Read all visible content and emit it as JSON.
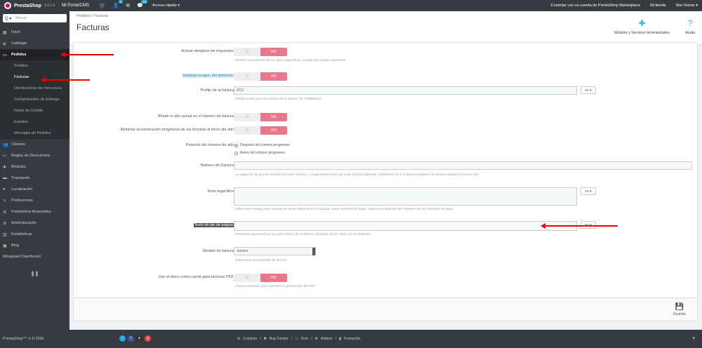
{
  "topbar": {
    "brand": "PrestaShop",
    "version": "1.6.1.5",
    "shop": "Mi Portal/CMS",
    "orders_badge": "1",
    "messages_badge": "13",
    "quick_access": "Acceso rápido ▾",
    "connect": "Conectar con su cuenta de PrestaShop Marketplace",
    "my_shop": "Mi tienda",
    "user": "Site Owner ▾"
  },
  "sidebar": {
    "search_placeholder": "Buscar",
    "items": [
      {
        "label": "Inicio",
        "icon": "dashboard-icon"
      },
      {
        "label": "Catálogo",
        "icon": "tag-icon"
      },
      {
        "label": "Pedidos",
        "icon": "credit-card-icon"
      }
    ],
    "sub_items": [
      "Pedidos",
      "Facturas",
      "Devoluciones de mercancía",
      "Comprobantes de Entrega",
      "Notas de Crédito",
      "Estados",
      "Mensajes de Pedidos"
    ],
    "items_after": [
      {
        "label": "Clientes",
        "icon": "users-icon"
      },
      {
        "label": "Reglas de Descuentos",
        "icon": "ticket-icon"
      },
      {
        "label": "Módulos",
        "icon": "puzzle-icon"
      },
      {
        "label": "Transporte",
        "icon": "truck-icon"
      },
      {
        "label": "Localización",
        "icon": "globe-icon"
      },
      {
        "label": "Preferencias",
        "icon": "wrench-icon"
      },
      {
        "label": "Parámetros Avanzados",
        "icon": "cogs-icon"
      },
      {
        "label": "Administración",
        "icon": "cog-icon"
      },
      {
        "label": "Estadísticas",
        "icon": "bar-chart-icon"
      },
      {
        "label": "Blog",
        "icon": "picture-icon"
      },
      {
        "label": "Wireguard Dashboard",
        "icon": ""
      }
    ]
  },
  "header": {
    "breadcrumb": "Pedidos  /  Facturas",
    "title": "Facturas",
    "modules_label": "Módulos y Servicios recomendados",
    "help_label": "Ayuda"
  },
  "form": {
    "yes": "SÍ",
    "no": "NO",
    "tax_breakdown_label": "Activar desglose de impuestos",
    "tax_breakdown_help": "Mostrar un resumen de los tipos impositivos cuando hay varios impuestos.",
    "product_image_label": "Habilitar imagen del producto",
    "prefix_label": "Prefijo de la factura",
    "prefix_value": "#CU",
    "prefix_help": "Prefijo usado para el nombre de la factura (ej. FA000001).",
    "lang": "es ▾",
    "year_label": "Añadir el año actual en el número de factura",
    "reset_label": "Reiniciar la numeración progresiva de las facturas al inicio del año",
    "position_label": "Posición del número de año",
    "position_after": "Después del número progresivo",
    "position_before": "Antes del número progresivo",
    "number_label": "Número de Factura",
    "number_help": "La siguiente factura se iniciará con este número, y luego aumentará con cada factura adicional. Establecer en 0 si desea mantener el número actual (el cual es #1).",
    "legal_label": "Texto legal libre",
    "legal_help": "Utilice este campo para mostrar un texto adicional en la factura, como información legal. Aparecerá después del resumen de los métodos de pago.",
    "footer_label": "Texto de pie de página",
    "footer_help": "Este texto aparecerá en la parte inferior de la factura, después de los datos de su empresa.",
    "model_label": "Modelo de factura",
    "model_value": "invoice",
    "model_help": "Seleccione una plantilla de factura.",
    "cache_label": "Use el disco como caché para facturas PDF",
    "cache_help": "Ahorra memoria, pero ralentiza la generación de PDF.",
    "save": "Guardar"
  },
  "bottombar": {
    "left": "PrestaShop™  ⊙ 0.153s",
    "links": [
      "Contacto",
      "Bug Tracker",
      "Foro",
      "Addons",
      "Formación"
    ]
  }
}
